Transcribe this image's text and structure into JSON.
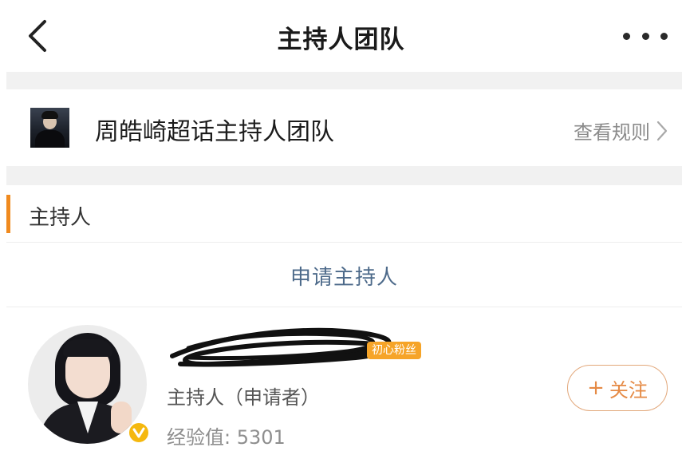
{
  "header": {
    "title": "主持人团队",
    "back_icon": "chevron-left-icon",
    "more_icon": "more-horizontal-icon"
  },
  "community": {
    "name": "周皓崎超话主持人团队",
    "rules_label": "查看规则",
    "rules_icon": "chevron-right-icon"
  },
  "section": {
    "title": "主持人",
    "accent_color": "#f08a1e"
  },
  "apply": {
    "label": "申请主持人"
  },
  "host": {
    "username": "",
    "badge": "初心粉丝",
    "role": "主持人（申请者）",
    "exp": "经验值: 5301",
    "follow_label": "关注",
    "follow_icon": "plus-icon",
    "verified_icon": "verified-v-icon"
  }
}
